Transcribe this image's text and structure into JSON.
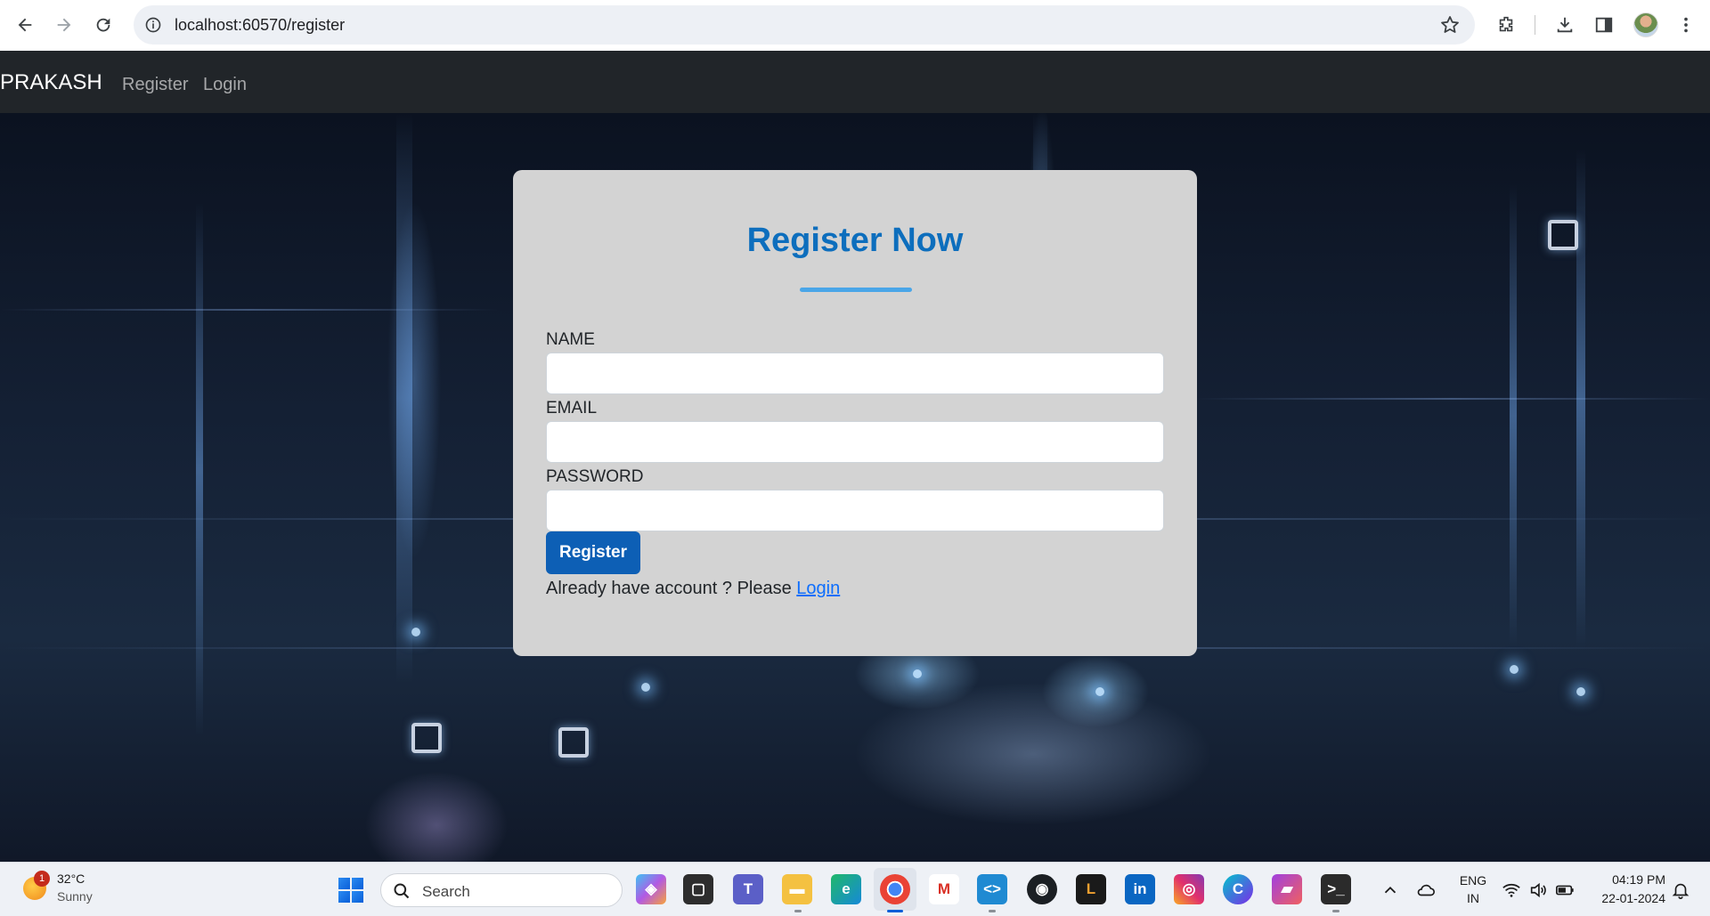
{
  "browser": {
    "url": "localhost:60570/register"
  },
  "navbar": {
    "brand": "PRAKASH",
    "links": [
      "Register",
      "Login"
    ]
  },
  "form": {
    "title": "Register Now",
    "fields": [
      {
        "label": "NAME",
        "value": ""
      },
      {
        "label": "EMAIL",
        "value": ""
      },
      {
        "label": "PASSWORD",
        "value": ""
      }
    ],
    "submit_label": "Register",
    "footer_text": "Already have account ? Please ",
    "footer_link": "Login"
  },
  "taskbar": {
    "weather_badge": "1",
    "weather_temp": "32°C",
    "weather_desc": "Sunny",
    "search_placeholder": "Search",
    "lang_top": "ENG",
    "lang_bottom": "IN",
    "time": "04:19 PM",
    "date": "22-01-2024"
  },
  "colors": {
    "navbar_bg": "#212529",
    "card_bg": "#d3d3d3",
    "title": "#0d6ebd",
    "button": "#0d5fb5",
    "link": "#0d6efd"
  }
}
